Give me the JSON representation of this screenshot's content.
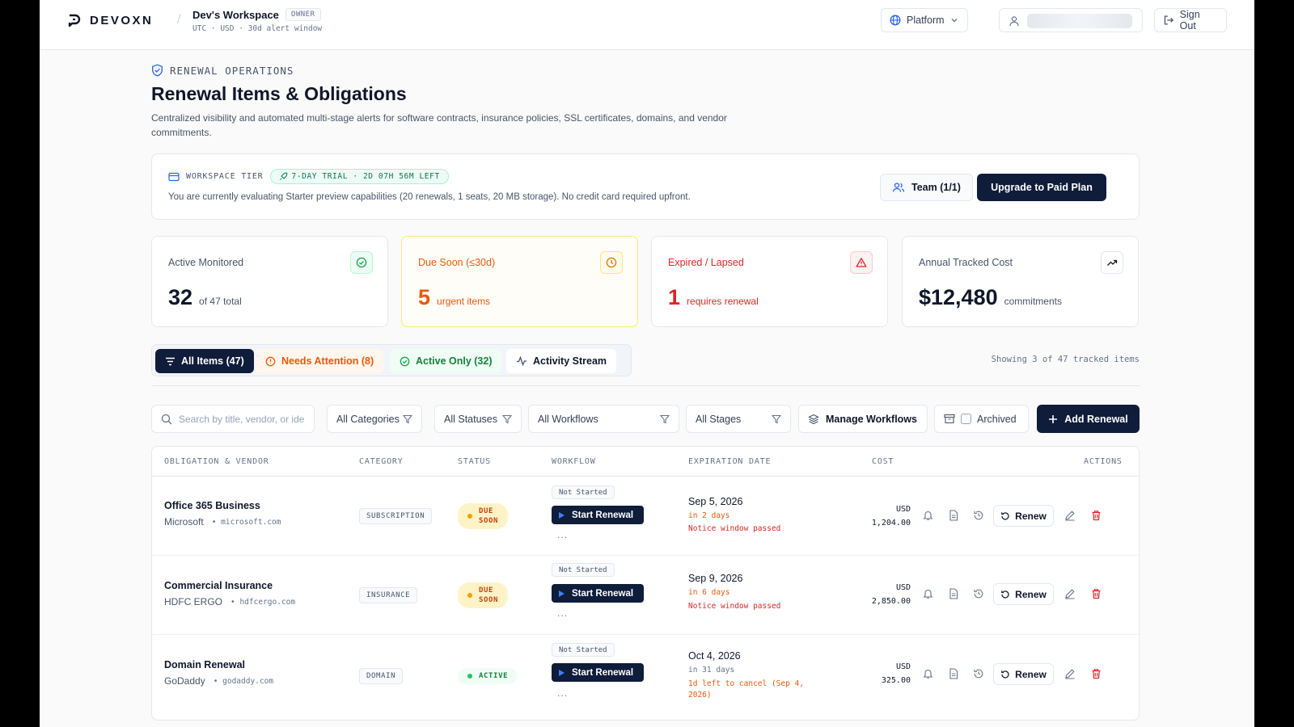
{
  "brand": {
    "name": "DEVOXN"
  },
  "workspace": {
    "name": "Dev's Workspace",
    "role": "OWNER",
    "meta": "UTC · USD · 30d alert window"
  },
  "topbar": {
    "platform_label": "Platform",
    "signout_label": "Sign Out"
  },
  "header": {
    "crumb": "RENEWAL OPERATIONS",
    "title": "Renewal Items & Obligations",
    "description": "Centralized visibility and automated multi-stage alerts for software contracts, insurance policies, SSL certificates, domains, and vendor commitments."
  },
  "tier": {
    "label": "WORKSPACE TIER",
    "trial": "7-DAY TRIAL · 2D 07H 56M LEFT",
    "text": "You are currently evaluating Starter preview capabilities (20 renewals, 1 seats, 20 MB storage). No credit card required upfront.",
    "team_label": "Team (1/1)",
    "upgrade_label": "Upgrade to Paid Plan"
  },
  "stats": [
    {
      "label": "Active Monitored",
      "value": "32",
      "sub": "of 47 total",
      "color": "#0f172a"
    },
    {
      "label": "Due Soon (≤30d)",
      "value": "5",
      "sub": "urgent items",
      "color": "#ea580c"
    },
    {
      "label": "Expired / Lapsed",
      "value": "1",
      "sub": "requires renewal",
      "color": "#dc2626"
    },
    {
      "label": "Annual Tracked Cost",
      "value": "$12,480",
      "sub": "commitments",
      "color": "#0f172a"
    }
  ],
  "tabs": [
    {
      "label": "All Items (47)"
    },
    {
      "label": "Needs Attention (8)"
    },
    {
      "label": "Active Only (32)"
    },
    {
      "label": "Activity Stream"
    }
  ],
  "showing": "Showing 3 of 47 tracked items",
  "filters": {
    "search_placeholder": "Search by title, vendor, or ide",
    "categories": "All Categories",
    "statuses": "All Statuses",
    "workflows": "All Workflows",
    "stages": "All Stages",
    "manage_label": "Manage Workflows",
    "archived_label": "Archived",
    "add_label": "Add Renewal"
  },
  "table": {
    "headers": [
      "OBLIGATION & VENDOR",
      "CATEGORY",
      "STATUS",
      "WORKFLOW",
      "EXPIRATION DATE",
      "COST",
      "ACTIONS"
    ],
    "rows": [
      {
        "title": "Office 365 Business",
        "vendor": "Microsoft",
        "domain": "• microsoft.com",
        "category": "SUBSCRIPTION",
        "status_1": "DUE",
        "status_2": "SOON",
        "workflow_state": "Not Started",
        "workflow_action": "Start Renewal",
        "workflow_more": "...",
        "date": "Sep 5, 2026",
        "line1": "in 2 days",
        "line2": "Notice window passed",
        "line3": "",
        "currency": "USD",
        "amount": "1,204.00",
        "renew_label": "Renew"
      },
      {
        "title": "Commercial Insurance",
        "vendor": "HDFC ERGO",
        "domain": "• hdfcergo.com",
        "category": "INSURANCE",
        "status_1": "DUE",
        "status_2": "SOON",
        "workflow_state": "Not Started",
        "workflow_action": "Start Renewal",
        "workflow_more": "...",
        "date": "Sep 9, 2026",
        "line1": "in 6 days",
        "line2": "Notice window passed",
        "line3": "",
        "currency": "USD",
        "amount": "2,850.00",
        "renew_label": "Renew"
      },
      {
        "title": "Domain Renewal",
        "vendor": "GoDaddy",
        "domain": "• godaddy.com",
        "category": "DOMAIN",
        "status_1": "ACTIVE",
        "status_2": "",
        "workflow_state": "Not Started",
        "workflow_action": "Start Renewal",
        "workflow_more": "...",
        "date": "Oct 4, 2026",
        "line1": "in 31 days",
        "line2": "1d left to cancel (Sep 4,",
        "line3": "2026)",
        "currency": "USD",
        "amount": "325.00",
        "renew_label": "Renew"
      }
    ]
  },
  "colors": {
    "navy": "#0f1c3a",
    "due": "#ea580c",
    "danger": "#dc2626",
    "active": "#15803d"
  },
  "icons": [
    "logo-icon",
    "globe-icon",
    "chevron-down-icon",
    "user-icon",
    "signout-icon",
    "shield-icon",
    "card-icon",
    "rocket-icon",
    "team-icon",
    "check-circle-icon",
    "clock-icon",
    "alert-triangle-icon",
    "trend-up-icon",
    "filter-icon",
    "alert-circle-icon",
    "activity-icon",
    "search-icon",
    "funnel-icon",
    "layers-icon",
    "archive-icon",
    "plus-icon",
    "play-icon",
    "bell-icon",
    "document-icon",
    "history-icon",
    "renew-icon",
    "edit-icon",
    "trash-icon"
  ]
}
